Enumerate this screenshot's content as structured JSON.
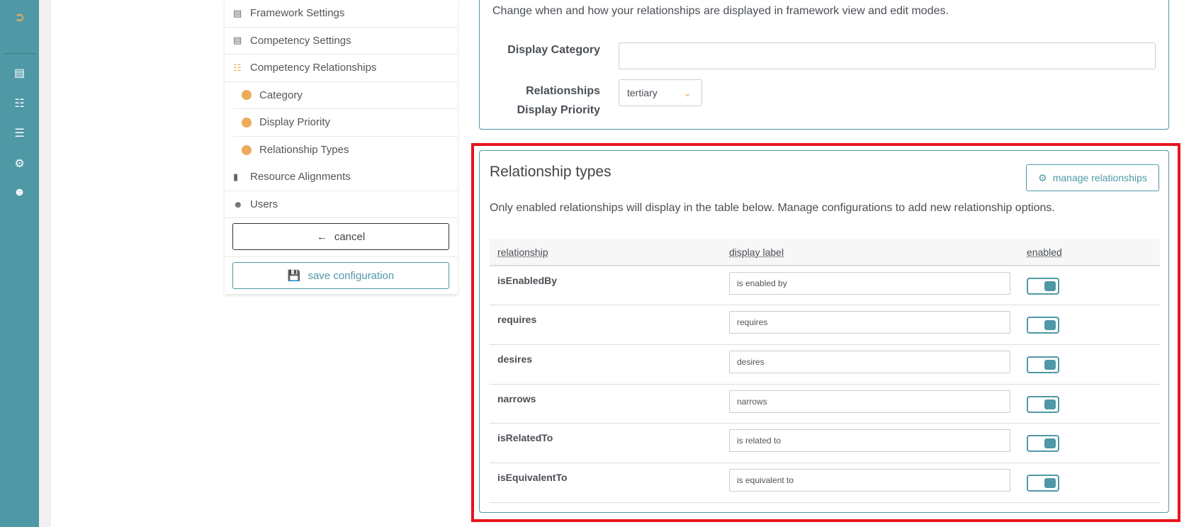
{
  "rail": {
    "icons": [
      "sign-out-icon",
      "list-icon",
      "sitemap-icon",
      "layers-icon",
      "gear-icon",
      "users-icon"
    ]
  },
  "menu": {
    "items": [
      {
        "label": "Framework Settings",
        "icon": "list-icon"
      },
      {
        "label": "Competency Settings",
        "icon": "list-icon"
      },
      {
        "label": "Competency Relationships",
        "icon": "sitemap-icon"
      },
      {
        "label": "Category",
        "icon": "dot"
      },
      {
        "label": "Display Priority",
        "icon": "dot"
      },
      {
        "label": "Relationship Types",
        "icon": "dot"
      },
      {
        "label": "Resource Alignments",
        "icon": "book-icon"
      },
      {
        "label": "Users",
        "icon": "users-icon"
      }
    ],
    "cancel": "cancel",
    "save": "save configuration"
  },
  "display": {
    "description": "Change when and how your relationships are displayed in framework view and edit modes.",
    "category_label": "Display Category",
    "category_value": "",
    "priority_label_1": "Relationships",
    "priority_label_2": "Display Priority",
    "priority_value": "tertiary"
  },
  "types": {
    "title": "Relationship types",
    "manage": "manage relationships",
    "description": "Only enabled relationships will display in the table below. Manage configurations to add new relationship options.",
    "headers": [
      "relationship",
      "display label",
      "enabled"
    ],
    "rows": [
      {
        "relationship": "isEnabledBy",
        "label": "is enabled by",
        "enabled": true
      },
      {
        "relationship": "requires",
        "label": "requires",
        "enabled": true
      },
      {
        "relationship": "desires",
        "label": "desires",
        "enabled": true
      },
      {
        "relationship": "narrows",
        "label": "narrows",
        "enabled": true
      },
      {
        "relationship": "isRelatedTo",
        "label": "is related to",
        "enabled": true
      },
      {
        "relationship": "isEquivalentTo",
        "label": "is equivalent to",
        "enabled": true
      }
    ]
  },
  "colors": {
    "accent": "#4f98a6",
    "orange": "#eeaa5b",
    "highlight": "#e8141e"
  }
}
